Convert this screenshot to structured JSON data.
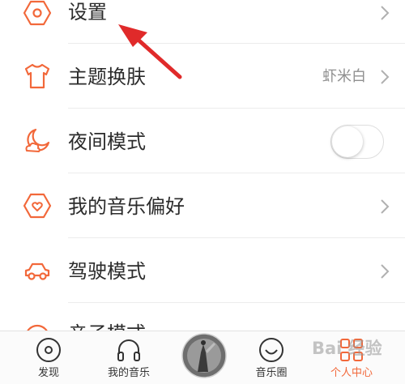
{
  "menu": {
    "settings": {
      "label": "设置",
      "icon": "hexagon-gear-icon"
    },
    "theme": {
      "label": "主题换肤",
      "value": "虾米白",
      "icon": "tshirt-icon"
    },
    "night_mode": {
      "label": "夜间模式",
      "icon": "moon-cloud-icon",
      "toggle_on": false
    },
    "music_pref": {
      "label": "我的音乐偏好",
      "icon": "hexagon-heart-icon"
    },
    "driving": {
      "label": "驾驶模式",
      "icon": "car-icon"
    },
    "next_item": {
      "label": "亲子模式"
    }
  },
  "bottom_nav": {
    "items": [
      {
        "label": "发现",
        "icon": "disc-icon"
      },
      {
        "label": "我的音乐",
        "icon": "headphones-icon"
      },
      {
        "label": "",
        "icon": "now-playing-cover"
      },
      {
        "label": "音乐圈",
        "icon": "smiley-icon"
      },
      {
        "label": "个人中心",
        "icon": "grid-icon",
        "active": true
      }
    ]
  },
  "watermark": "Bai 经验",
  "colors": {
    "accent": "#f2683a",
    "text": "#2b2b2b",
    "muted": "#8f8f8f"
  }
}
